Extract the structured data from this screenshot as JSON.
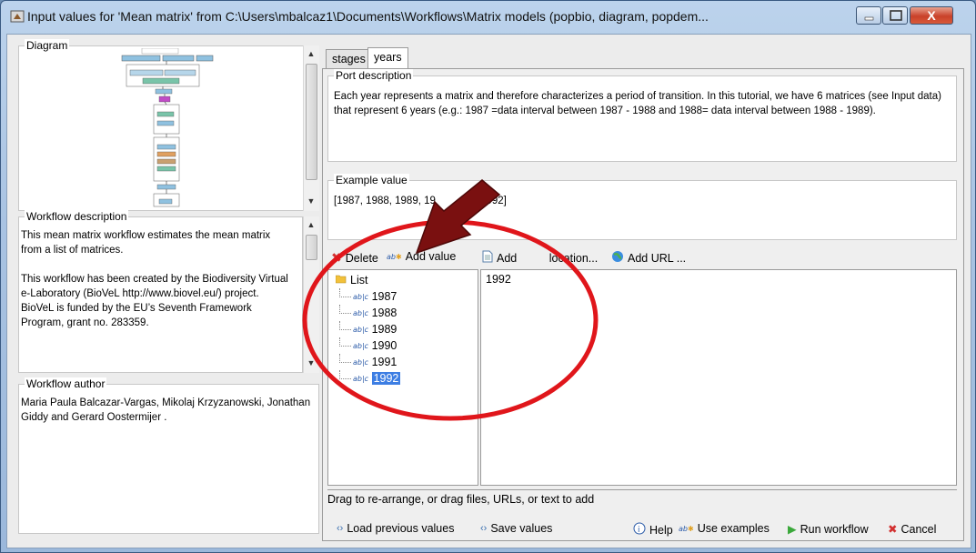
{
  "window": {
    "title": "Input values for 'Mean matrix' from C:\\Users\\mbalcaz1\\Documents\\Workflows\\Matrix models (popbio, diagram, popdem...",
    "close_label": "X"
  },
  "left": {
    "diagram_legend": "Diagram",
    "workflow_description": {
      "legend": "Workflow description",
      "text": "This mean matrix workflow estimates the mean matrix from a list of matrices.\n\nThis workflow has been created by the Biodiversity Virtual e-Laboratory (BioVeL http://www.biovel.eu/) project. BioVeL is funded by the EU’s Seventh Framework Program, grant no. 283359."
    },
    "workflow_author": {
      "legend": "Workflow author",
      "text": "Maria Paula Balcazar-Vargas, Mikolaj Krzyzanowski, Jonathan Giddy and Gerard Oostermijer ."
    }
  },
  "tabs": [
    "stages",
    "years"
  ],
  "port_description": {
    "legend": "Port description",
    "text": "Each year represents a matrix and therefore characterizes a period of transition. In this tutorial, we have 6 matrices (see  Input data) that represent 6 years (e.g.: 1987 =data interval between 1987 - 1988 and 1988= data interval between 1988 - 1989)."
  },
  "example_value": {
    "legend": "Example value",
    "text": "[1987, 1988, 1989, 19",
    "text_tail": "91, 1992]"
  },
  "toolbar": {
    "delete": "Delete",
    "add_value": "Add value",
    "add_file": "Add file location...",
    "add_url": "Add URL ...",
    "add_file_visible": "Add ",
    "add_file_tail": "location..."
  },
  "tree": {
    "root": "List",
    "items": [
      "1987",
      "1988",
      "1989",
      "1990",
      "1991",
      "1992"
    ],
    "selected": "1992"
  },
  "value_editor": {
    "value": "1992"
  },
  "hint": "Drag to re-arrange, or drag files, URLs, or text to add",
  "footer": {
    "load_previous": "Load previous values",
    "save_values": "Save values",
    "help": "Help",
    "use_examples": "Use examples",
    "run_workflow": "Run workflow",
    "cancel": "Cancel"
  },
  "colors": {
    "annotation_red": "#e0161b",
    "arrow_dark_red": "#7a1010",
    "selection_blue": "#3d7ee3"
  }
}
